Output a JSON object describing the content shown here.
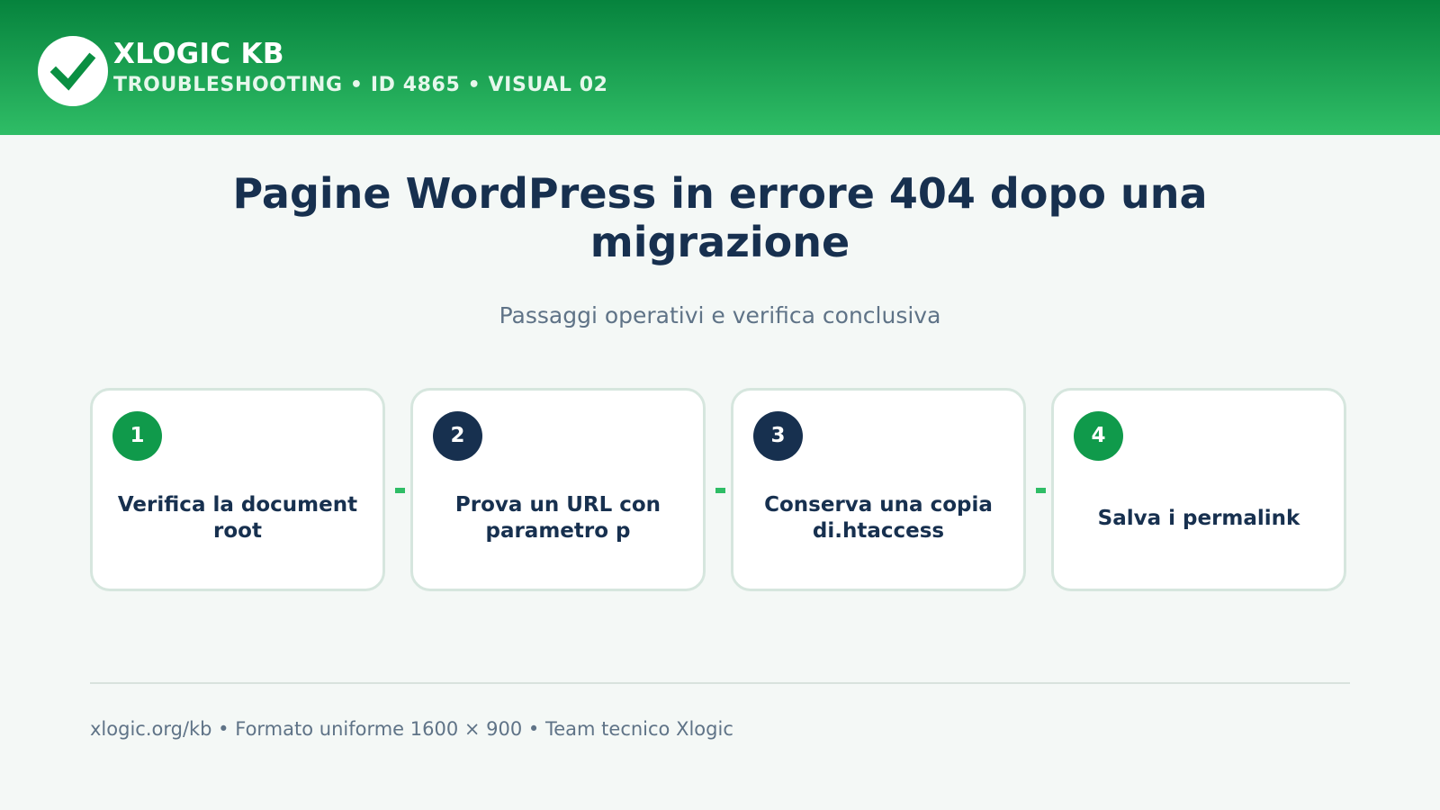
{
  "header": {
    "brand": "XLOGIC KB",
    "meta": "TROUBLESHOOTING • ID 4865 • VISUAL 02",
    "logo_icon": "check-circle-icon"
  },
  "main": {
    "title": "Pagine WordPress in errore 404 dopo una migrazione",
    "subtitle": "Passaggi operativi e verifica conclusiva",
    "steps": [
      {
        "number": "1",
        "label": "Verifica la document root"
      },
      {
        "number": "2",
        "label": "Prova un URL con parametro p"
      },
      {
        "number": "3",
        "label": "Conserva una copia di.htaccess"
      },
      {
        "number": "4",
        "label": "Salva i permalink"
      }
    ]
  },
  "footer": {
    "text": "xlogic.org/kb • Formato uniforme 1600 × 900 • Team tecnico Xlogic"
  },
  "colors": {
    "header_dark": "#06833d",
    "header_light": "#2fbd66",
    "title": "#17304f",
    "badge_green": "#109a4b",
    "badge_navy": "#17304f",
    "connector": "#2fbd66",
    "background": "#f4f8f6"
  }
}
